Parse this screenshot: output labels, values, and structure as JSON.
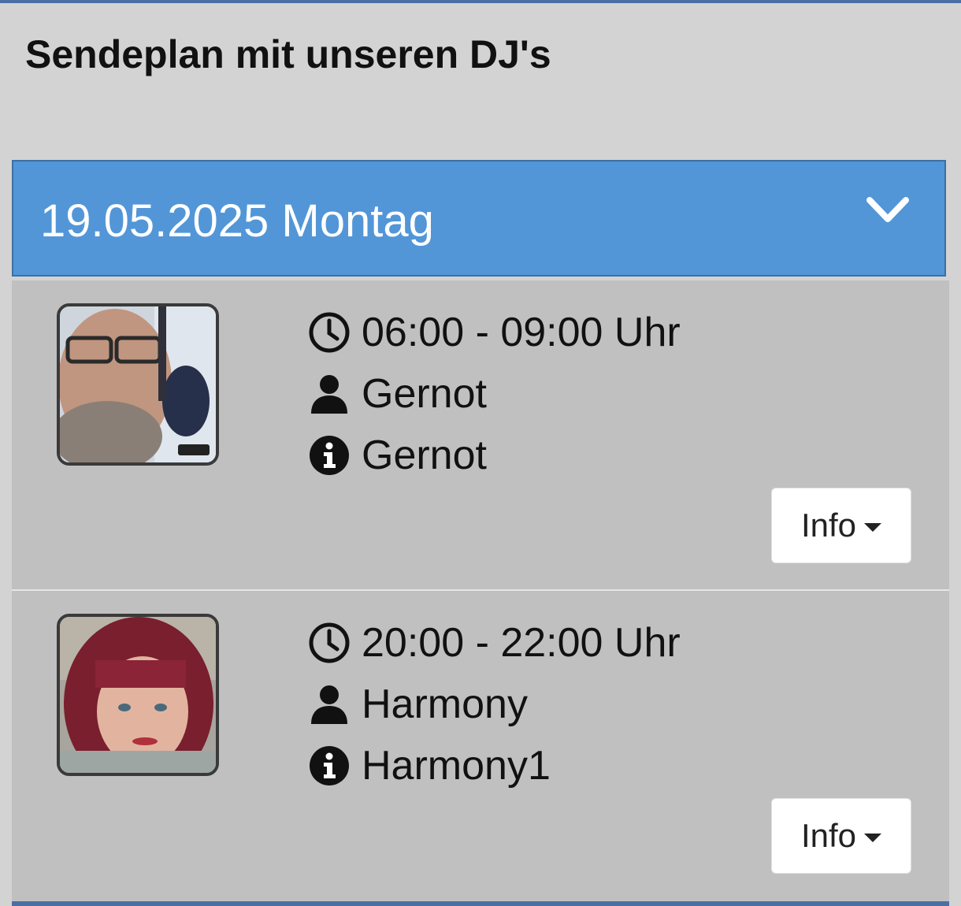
{
  "page": {
    "title": "Sendeplan mit unseren DJ's"
  },
  "day": {
    "label": "19.05.2025 Montag",
    "expanded": true,
    "icon": "chevron-down-icon"
  },
  "colors": {
    "header_bg": "#5296d8",
    "slot_bg": "#c0c0c0",
    "page_bg": "#d3d3d3",
    "accent_line": "#4a6fa5"
  },
  "slots": [
    {
      "time": "06:00 - 09:00 Uhr",
      "dj": "Gernot",
      "info": "Gernot",
      "button_label": "Info"
    },
    {
      "time": "20:00 - 22:00 Uhr",
      "dj": "Harmony",
      "info": "Harmony1",
      "button_label": "Info"
    }
  ]
}
